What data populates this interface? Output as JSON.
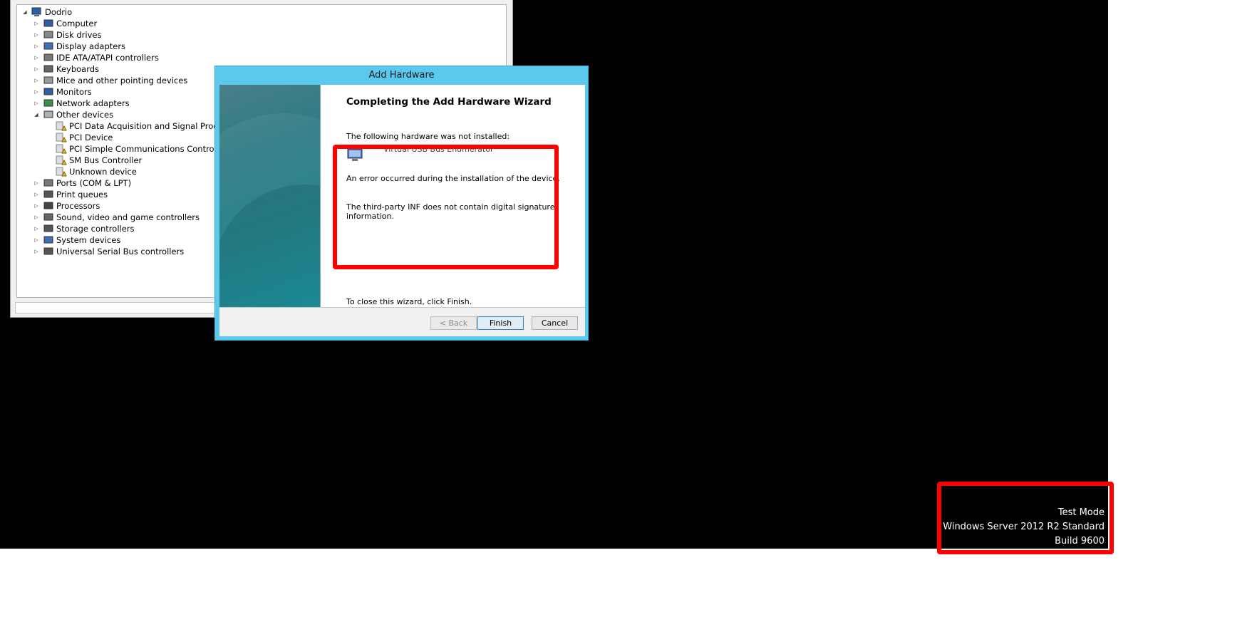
{
  "device_manager": {
    "root": "Dodrio",
    "items": [
      {
        "label": "Computer",
        "icon": "computer-icon",
        "expanded": false
      },
      {
        "label": "Disk drives",
        "icon": "disk-icon",
        "expanded": false
      },
      {
        "label": "Display adapters",
        "icon": "display-icon",
        "expanded": false
      },
      {
        "label": "IDE ATA/ATAPI controllers",
        "icon": "ide-icon",
        "expanded": false
      },
      {
        "label": "Keyboards",
        "icon": "keyboard-icon",
        "expanded": false
      },
      {
        "label": "Mice and other pointing devices",
        "icon": "mouse-icon",
        "expanded": false
      },
      {
        "label": "Monitors",
        "icon": "monitor-icon",
        "expanded": false
      },
      {
        "label": "Network adapters",
        "icon": "network-icon",
        "expanded": false
      },
      {
        "label": "Other devices",
        "icon": "other-devices-icon",
        "expanded": true
      },
      {
        "label": "PCI Data Acquisition and Signal Processing C",
        "icon": "warning-device-icon",
        "child": true
      },
      {
        "label": "PCI Device",
        "icon": "warning-device-icon",
        "child": true
      },
      {
        "label": "PCI Simple Communications Controller",
        "icon": "warning-device-icon",
        "child": true
      },
      {
        "label": "SM Bus Controller",
        "icon": "warning-device-icon",
        "child": true
      },
      {
        "label": "Unknown device",
        "icon": "warning-device-icon",
        "child": true
      },
      {
        "label": "Ports (COM & LPT)",
        "icon": "port-icon",
        "expanded": false
      },
      {
        "label": "Print queues",
        "icon": "printer-icon",
        "expanded": false
      },
      {
        "label": "Processors",
        "icon": "processor-icon",
        "expanded": false
      },
      {
        "label": "Sound, video and game controllers",
        "icon": "sound-icon",
        "expanded": false
      },
      {
        "label": "Storage controllers",
        "icon": "storage-icon",
        "expanded": false
      },
      {
        "label": "System devices",
        "icon": "system-icon",
        "expanded": false
      },
      {
        "label": "Universal Serial Bus controllers",
        "icon": "usb-icon",
        "expanded": false
      }
    ]
  },
  "dialog": {
    "title": "Add Hardware",
    "heading": "Completing the Add Hardware Wizard",
    "not_installed": "The following hardware was not installed:",
    "device_name": "Virtual USB Bus Enumerator",
    "error": "An error occurred during the installation of the device.",
    "reason_line1": "The third-party INF does not contain digital signature",
    "reason_line2": "information.",
    "close_hint": "To close this wizard, click Finish.",
    "buttons": {
      "back": "< Back",
      "finish": "Finish",
      "cancel": "Cancel"
    }
  },
  "watermark": {
    "line1": "Test Mode",
    "line2": "Windows Server 2012 R2 Standard",
    "line3": "Build 9600"
  },
  "colors": {
    "accent_title": "#5bc9ee",
    "highlight": "#ff0000"
  }
}
